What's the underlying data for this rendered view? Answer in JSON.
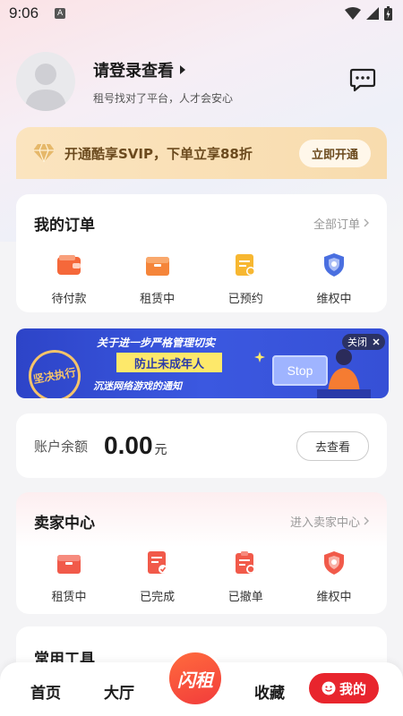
{
  "status": {
    "time": "9:06",
    "badge": "A"
  },
  "profile": {
    "title": "请登录查看",
    "subtitle": "租号找对了平台，人才会安心"
  },
  "vip": {
    "text": "开通酷享SVIP，下单立享88折",
    "button": "立即开通"
  },
  "orders": {
    "title": "我的订单",
    "link": "全部订单",
    "items": [
      {
        "label": "待付款",
        "icon": "wallet-icon"
      },
      {
        "label": "租赁中",
        "icon": "box-icon"
      },
      {
        "label": "已预约",
        "icon": "clipboard-icon"
      },
      {
        "label": "维权中",
        "icon": "shield-icon"
      }
    ]
  },
  "banner": {
    "line1": "关于进一步严格管理切实",
    "line2": "防止未成年人",
    "line3": "沉迷网络游戏的通知",
    "seal": "坚决执行",
    "stop": "Stop",
    "close": "关闭"
  },
  "balance": {
    "label": "账户余额",
    "value": "0.00",
    "unit": "元",
    "button": "去查看"
  },
  "seller": {
    "title": "卖家中心",
    "link": "进入卖家中心",
    "items": [
      {
        "label": "租赁中",
        "icon": "box-icon"
      },
      {
        "label": "已完成",
        "icon": "doc-check-icon"
      },
      {
        "label": "已撤单",
        "icon": "clipboard-cancel-icon"
      },
      {
        "label": "维权中",
        "icon": "shield-icon"
      }
    ]
  },
  "tools": {
    "title": "常用工具"
  },
  "tabbar": {
    "home": "首页",
    "hall": "大厅",
    "center": "闪租",
    "favorites": "收藏",
    "mine": "我的"
  },
  "colors": {
    "accent": "#e8252d",
    "orange": "#f5683a",
    "gold": "#f8dcae",
    "blue": "#4a6fe0"
  }
}
